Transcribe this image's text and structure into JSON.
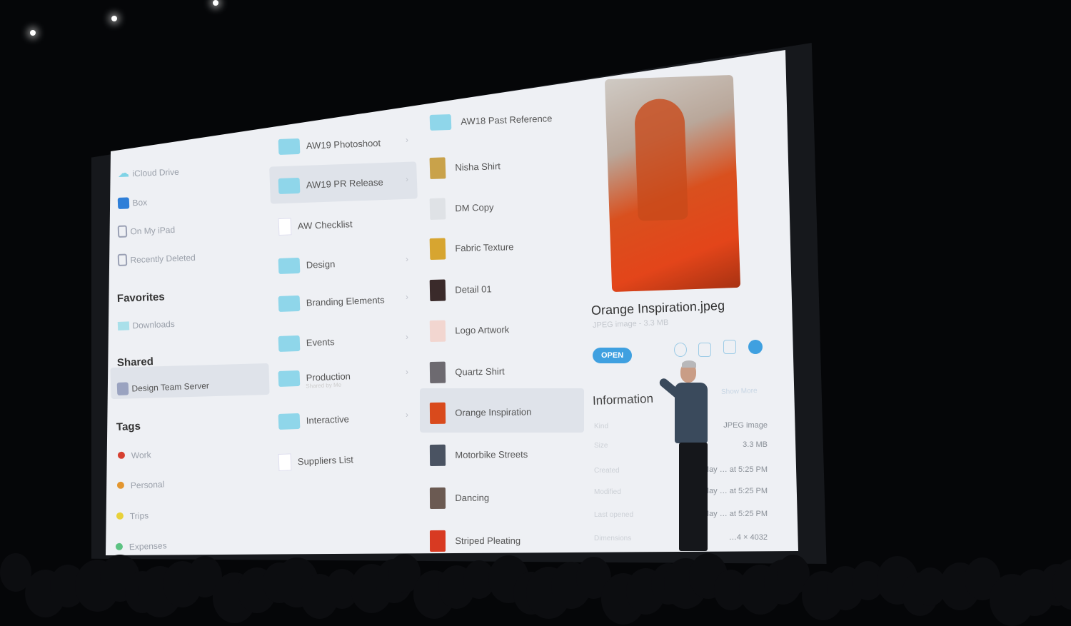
{
  "sidebar": {
    "locations": [
      {
        "label": "iCloud Drive",
        "icon": "cloud-icon"
      },
      {
        "label": "Box",
        "icon": "box-icon"
      },
      {
        "label": "On My iPad",
        "icon": "ipad-icon"
      },
      {
        "label": "Recently Deleted",
        "icon": "trash-icon"
      }
    ],
    "favorites_header": "Favorites",
    "favorites": [
      {
        "label": "Downloads",
        "icon": "folder-icon"
      }
    ],
    "shared_header": "Shared",
    "shared": [
      {
        "label": "Design Team Server",
        "icon": "server-icon",
        "selected": true
      }
    ],
    "tags_header": "Tags",
    "tags": [
      {
        "label": "Work",
        "color": "#d64031"
      },
      {
        "label": "Personal",
        "color": "#e3962f"
      },
      {
        "label": "Trips",
        "color": "#e8d13a"
      },
      {
        "label": "Expenses",
        "color": "#5cc282"
      }
    ]
  },
  "column2": [
    {
      "label": "AW19 Photoshoot",
      "type": "folder"
    },
    {
      "label": "AW19 PR Release",
      "type": "folder",
      "selected": true
    },
    {
      "label": "AW Checklist",
      "type": "document"
    },
    {
      "label": "Design",
      "type": "shared-folder"
    },
    {
      "label": "Branding Elements",
      "type": "folder"
    },
    {
      "label": "Events",
      "type": "folder"
    },
    {
      "label": "Production",
      "type": "shared-folder",
      "sub": "Shared by Me"
    },
    {
      "label": "Interactive",
      "type": "folder"
    },
    {
      "label": "Suppliers List",
      "type": "document"
    }
  ],
  "column3": [
    {
      "label": "AW18 Past Reference",
      "type": "folder"
    },
    {
      "label": "Nisha Shirt",
      "color": "#c9a24a"
    },
    {
      "label": "DM Copy",
      "color": "#dfe2e6"
    },
    {
      "label": "Fabric Texture",
      "color": "#d7a530"
    },
    {
      "label": "Detail 01",
      "color": "#3a2a2a"
    },
    {
      "label": "Logo Artwork",
      "color": "#f2d6d0"
    },
    {
      "label": "Quartz Shirt",
      "color": "#6d6a70"
    },
    {
      "label": "Orange Inspiration",
      "color": "#d94a1c",
      "selected": true
    },
    {
      "label": "Motorbike Streets",
      "color": "#4a5362"
    },
    {
      "label": "Dancing",
      "color": "#6b5a52"
    },
    {
      "label": "Striped Pleating",
      "color": "#d83a22"
    }
  ],
  "preview": {
    "filename": "Orange Inspiration.jpeg",
    "subtitle": "JPEG image - 3.3 MB",
    "open_label": "OPEN",
    "actions": [
      "markup-icon",
      "share-icon",
      "pdf-icon",
      "more-icon"
    ],
    "info_header": "Information",
    "show_more": "Show More",
    "info": [
      {
        "label": "Kind",
        "value": "JPEG image"
      },
      {
        "label": "Size",
        "value": "3.3 MB"
      },
      {
        "label": "Created",
        "value": "May … at 5:25 PM"
      },
      {
        "label": "Modified",
        "value": "May … at 5:25 PM"
      },
      {
        "label": "Last opened",
        "value": "May … at 5:25 PM"
      },
      {
        "label": "Dimensions",
        "value": "…4 × 4032"
      }
    ]
  },
  "colors": {
    "accent": "#3fa0e0",
    "folder": "#8fd6ea",
    "stage": "#050608"
  }
}
